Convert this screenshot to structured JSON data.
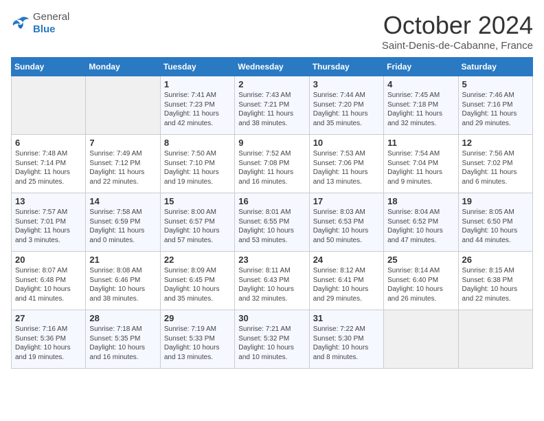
{
  "header": {
    "logo_general": "General",
    "logo_blue": "Blue",
    "month_title": "October 2024",
    "location": "Saint-Denis-de-Cabanne, France"
  },
  "days_of_week": [
    "Sunday",
    "Monday",
    "Tuesday",
    "Wednesday",
    "Thursday",
    "Friday",
    "Saturday"
  ],
  "weeks": [
    [
      {
        "num": "",
        "sunrise": "",
        "sunset": "",
        "daylight": ""
      },
      {
        "num": "",
        "sunrise": "",
        "sunset": "",
        "daylight": ""
      },
      {
        "num": "1",
        "sunrise": "Sunrise: 7:41 AM",
        "sunset": "Sunset: 7:23 PM",
        "daylight": "Daylight: 11 hours and 42 minutes."
      },
      {
        "num": "2",
        "sunrise": "Sunrise: 7:43 AM",
        "sunset": "Sunset: 7:21 PM",
        "daylight": "Daylight: 11 hours and 38 minutes."
      },
      {
        "num": "3",
        "sunrise": "Sunrise: 7:44 AM",
        "sunset": "Sunset: 7:20 PM",
        "daylight": "Daylight: 11 hours and 35 minutes."
      },
      {
        "num": "4",
        "sunrise": "Sunrise: 7:45 AM",
        "sunset": "Sunset: 7:18 PM",
        "daylight": "Daylight: 11 hours and 32 minutes."
      },
      {
        "num": "5",
        "sunrise": "Sunrise: 7:46 AM",
        "sunset": "Sunset: 7:16 PM",
        "daylight": "Daylight: 11 hours and 29 minutes."
      }
    ],
    [
      {
        "num": "6",
        "sunrise": "Sunrise: 7:48 AM",
        "sunset": "Sunset: 7:14 PM",
        "daylight": "Daylight: 11 hours and 25 minutes."
      },
      {
        "num": "7",
        "sunrise": "Sunrise: 7:49 AM",
        "sunset": "Sunset: 7:12 PM",
        "daylight": "Daylight: 11 hours and 22 minutes."
      },
      {
        "num": "8",
        "sunrise": "Sunrise: 7:50 AM",
        "sunset": "Sunset: 7:10 PM",
        "daylight": "Daylight: 11 hours and 19 minutes."
      },
      {
        "num": "9",
        "sunrise": "Sunrise: 7:52 AM",
        "sunset": "Sunset: 7:08 PM",
        "daylight": "Daylight: 11 hours and 16 minutes."
      },
      {
        "num": "10",
        "sunrise": "Sunrise: 7:53 AM",
        "sunset": "Sunset: 7:06 PM",
        "daylight": "Daylight: 11 hours and 13 minutes."
      },
      {
        "num": "11",
        "sunrise": "Sunrise: 7:54 AM",
        "sunset": "Sunset: 7:04 PM",
        "daylight": "Daylight: 11 hours and 9 minutes."
      },
      {
        "num": "12",
        "sunrise": "Sunrise: 7:56 AM",
        "sunset": "Sunset: 7:02 PM",
        "daylight": "Daylight: 11 hours and 6 minutes."
      }
    ],
    [
      {
        "num": "13",
        "sunrise": "Sunrise: 7:57 AM",
        "sunset": "Sunset: 7:01 PM",
        "daylight": "Daylight: 11 hours and 3 minutes."
      },
      {
        "num": "14",
        "sunrise": "Sunrise: 7:58 AM",
        "sunset": "Sunset: 6:59 PM",
        "daylight": "Daylight: 11 hours and 0 minutes."
      },
      {
        "num": "15",
        "sunrise": "Sunrise: 8:00 AM",
        "sunset": "Sunset: 6:57 PM",
        "daylight": "Daylight: 10 hours and 57 minutes."
      },
      {
        "num": "16",
        "sunrise": "Sunrise: 8:01 AM",
        "sunset": "Sunset: 6:55 PM",
        "daylight": "Daylight: 10 hours and 53 minutes."
      },
      {
        "num": "17",
        "sunrise": "Sunrise: 8:03 AM",
        "sunset": "Sunset: 6:53 PM",
        "daylight": "Daylight: 10 hours and 50 minutes."
      },
      {
        "num": "18",
        "sunrise": "Sunrise: 8:04 AM",
        "sunset": "Sunset: 6:52 PM",
        "daylight": "Daylight: 10 hours and 47 minutes."
      },
      {
        "num": "19",
        "sunrise": "Sunrise: 8:05 AM",
        "sunset": "Sunset: 6:50 PM",
        "daylight": "Daylight: 10 hours and 44 minutes."
      }
    ],
    [
      {
        "num": "20",
        "sunrise": "Sunrise: 8:07 AM",
        "sunset": "Sunset: 6:48 PM",
        "daylight": "Daylight: 10 hours and 41 minutes."
      },
      {
        "num": "21",
        "sunrise": "Sunrise: 8:08 AM",
        "sunset": "Sunset: 6:46 PM",
        "daylight": "Daylight: 10 hours and 38 minutes."
      },
      {
        "num": "22",
        "sunrise": "Sunrise: 8:09 AM",
        "sunset": "Sunset: 6:45 PM",
        "daylight": "Daylight: 10 hours and 35 minutes."
      },
      {
        "num": "23",
        "sunrise": "Sunrise: 8:11 AM",
        "sunset": "Sunset: 6:43 PM",
        "daylight": "Daylight: 10 hours and 32 minutes."
      },
      {
        "num": "24",
        "sunrise": "Sunrise: 8:12 AM",
        "sunset": "Sunset: 6:41 PM",
        "daylight": "Daylight: 10 hours and 29 minutes."
      },
      {
        "num": "25",
        "sunrise": "Sunrise: 8:14 AM",
        "sunset": "Sunset: 6:40 PM",
        "daylight": "Daylight: 10 hours and 26 minutes."
      },
      {
        "num": "26",
        "sunrise": "Sunrise: 8:15 AM",
        "sunset": "Sunset: 6:38 PM",
        "daylight": "Daylight: 10 hours and 22 minutes."
      }
    ],
    [
      {
        "num": "27",
        "sunrise": "Sunrise: 7:16 AM",
        "sunset": "Sunset: 5:36 PM",
        "daylight": "Daylight: 10 hours and 19 minutes."
      },
      {
        "num": "28",
        "sunrise": "Sunrise: 7:18 AM",
        "sunset": "Sunset: 5:35 PM",
        "daylight": "Daylight: 10 hours and 16 minutes."
      },
      {
        "num": "29",
        "sunrise": "Sunrise: 7:19 AM",
        "sunset": "Sunset: 5:33 PM",
        "daylight": "Daylight: 10 hours and 13 minutes."
      },
      {
        "num": "30",
        "sunrise": "Sunrise: 7:21 AM",
        "sunset": "Sunset: 5:32 PM",
        "daylight": "Daylight: 10 hours and 10 minutes."
      },
      {
        "num": "31",
        "sunrise": "Sunrise: 7:22 AM",
        "sunset": "Sunset: 5:30 PM",
        "daylight": "Daylight: 10 hours and 8 minutes."
      },
      {
        "num": "",
        "sunrise": "",
        "sunset": "",
        "daylight": ""
      },
      {
        "num": "",
        "sunrise": "",
        "sunset": "",
        "daylight": ""
      }
    ]
  ]
}
